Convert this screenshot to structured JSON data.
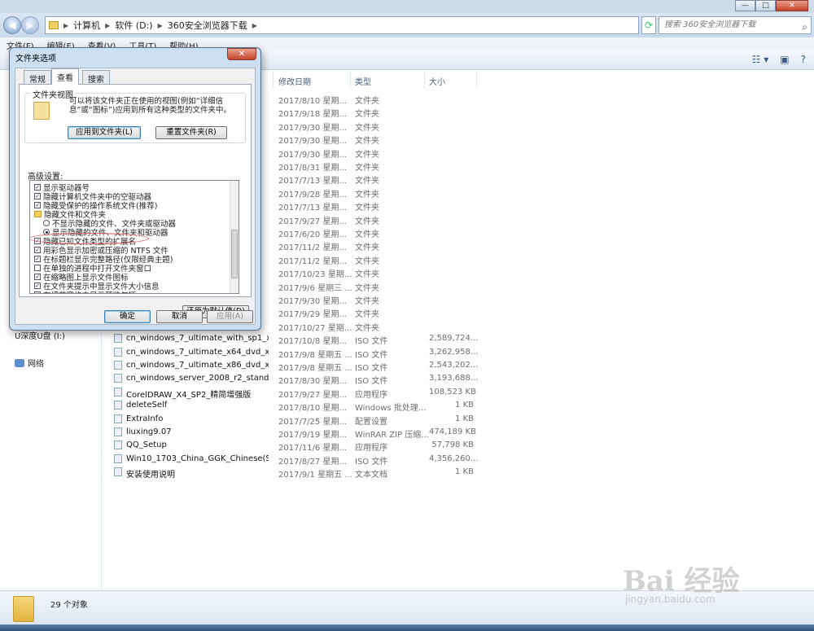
{
  "window": {
    "controls": {
      "minimize": "—",
      "maximize": "□",
      "close": "✕"
    }
  },
  "address": {
    "crumbs": [
      "计算机",
      "软件 (D:)",
      "360安全浏览器下载"
    ],
    "search_placeholder": "搜索 360安全浏览器下载"
  },
  "menu": [
    "文件(F)",
    "编辑(E)",
    "查看(V)",
    "工具(T)",
    "帮助(H)"
  ],
  "nav": [
    {
      "label": "U深度U盘 (I:)"
    },
    {
      "label": "网络"
    }
  ],
  "columns": {
    "date": "修改日期",
    "type": "类型",
    "size": "大小"
  },
  "files": [
    {
      "name": "",
      "date": "2017/8/10 星期...",
      "type": "文件夹",
      "size": ""
    },
    {
      "name": "",
      "date": "2017/9/18 星期...",
      "type": "文件夹",
      "size": ""
    },
    {
      "name": "",
      "date": "2017/9/30 星期...",
      "type": "文件夹",
      "size": ""
    },
    {
      "name": "",
      "date": "2017/9/30 星期...",
      "type": "文件夹",
      "size": ""
    },
    {
      "name": "",
      "date": "2017/9/30 星期...",
      "type": "文件夹",
      "size": ""
    },
    {
      "name": "",
      "date": "2017/8/31 星期...",
      "type": "文件夹",
      "size": ""
    },
    {
      "name": "",
      "date": "2017/7/13 星期...",
      "type": "文件夹",
      "size": ""
    },
    {
      "name": "",
      "date": "2017/9/28 星期...",
      "type": "文件夹",
      "size": ""
    },
    {
      "name": "",
      "date": "2017/7/13 星期...",
      "type": "文件夹",
      "size": ""
    },
    {
      "name": "",
      "date": "2017/9/27 星期...",
      "type": "文件夹",
      "size": ""
    },
    {
      "name": "",
      "date": "2017/6/20 星期...",
      "type": "文件夹",
      "size": ""
    },
    {
      "name": "",
      "date": "2017/11/2 星期...",
      "type": "文件夹",
      "size": ""
    },
    {
      "name": "",
      "date": "2017/11/2 星期...",
      "type": "文件夹",
      "size": ""
    },
    {
      "name": "",
      "date": "2017/10/23 星期...",
      "type": "文件夹",
      "size": ""
    },
    {
      "name": "",
      "date": "2017/9/6 星期三 ...",
      "type": "文件夹",
      "size": ""
    },
    {
      "name": "",
      "date": "2017/9/30 星期...",
      "type": "文件夹",
      "size": ""
    },
    {
      "name": "",
      "date": "2017/9/29 星期...",
      "type": "文件夹",
      "size": ""
    },
    {
      "name": "",
      "date": "2017/10/27 星期...",
      "type": "文件夹",
      "size": ""
    },
    {
      "name": "cn_windows_7_ultimate_with_sp1_x86_...",
      "date": "2017/10/8 星期...",
      "type": "ISO 文件",
      "size": "2,589,724..."
    },
    {
      "name": "cn_windows_7_ultimate_x64_dvd_x15-...",
      "date": "2017/9/8 星期五 ...",
      "type": "ISO 文件",
      "size": "3,262,958..."
    },
    {
      "name": "cn_windows_7_ultimate_x86_dvd_x15-...",
      "date": "2017/9/8 星期五 ...",
      "type": "ISO 文件",
      "size": "2,543,202..."
    },
    {
      "name": "cn_windows_server_2008_r2_standard...",
      "date": "2017/8/30 星期...",
      "type": "ISO 文件",
      "size": "3,193,688..."
    },
    {
      "name": "CorelDRAW_X4_SP2_精简增强版",
      "date": "2017/9/27 星期...",
      "type": "应用程序",
      "size": "108,523 KB"
    },
    {
      "name": "deleteSelf",
      "date": "2017/8/10 星期...",
      "type": "Windows 批处理...",
      "size": "1 KB"
    },
    {
      "name": "ExtraInfo",
      "date": "2017/7/25 星期...",
      "type": "配置设置",
      "size": "1 KB"
    },
    {
      "name": "liuxing9.07",
      "date": "2017/9/19 星期...",
      "type": "WinRAR ZIP 压缩...",
      "size": "474,189 KB"
    },
    {
      "name": "QQ_Setup",
      "date": "2017/11/6 星期...",
      "type": "应用程序",
      "size": "57,798 KB"
    },
    {
      "name": "Win10_1703_China_GGK_Chinese(Sim...",
      "date": "2017/8/27 星期...",
      "type": "ISO 文件",
      "size": "4,356,260..."
    },
    {
      "name": "安装使用说明",
      "date": "2017/9/1 星期五 ...",
      "type": "文本文档",
      "size": "1 KB"
    }
  ],
  "status": {
    "count": "29 个对象"
  },
  "dialog": {
    "title": "文件夹选项",
    "close": "✕",
    "tabs": [
      "常规",
      "查看",
      "搜索"
    ],
    "folder_views": {
      "legend": "文件夹视图",
      "description": "可以将该文件夹正在使用的视图(例如“详细信息”或“图标”)应用到所有这种类型的文件夹中。",
      "apply_btn": "应用到文件夹(L)",
      "reset_btn": "重置文件夹(R)"
    },
    "advanced_label": "高级设置:",
    "options": [
      {
        "kind": "checkbox",
        "checked": true,
        "label": "显示驱动器号"
      },
      {
        "kind": "checkbox",
        "checked": true,
        "label": "隐藏计算机文件夹中的空驱动器"
      },
      {
        "kind": "checkbox",
        "checked": true,
        "label": "隐藏受保护的操作系统文件(推荐)"
      },
      {
        "kind": "folder",
        "label": "隐藏文件和文件夹"
      },
      {
        "kind": "radio",
        "checked": false,
        "label": "不显示隐藏的文件、文件夹或驱动器",
        "indent": true
      },
      {
        "kind": "radio",
        "checked": true,
        "label": "显示隐藏的文件、文件夹和驱动器",
        "indent": true
      },
      {
        "kind": "checkbox",
        "checked": true,
        "label": "隐藏已知文件类型的扩展名"
      },
      {
        "kind": "checkbox",
        "checked": true,
        "label": "用彩色显示加密或压缩的 NTFS 文件"
      },
      {
        "kind": "checkbox",
        "checked": true,
        "label": "在标题栏显示完整路径(仅限经典主题)"
      },
      {
        "kind": "checkbox",
        "checked": false,
        "label": "在单独的进程中打开文件夹窗口"
      },
      {
        "kind": "checkbox",
        "checked": true,
        "label": "在缩略图上显示文件图标"
      },
      {
        "kind": "checkbox",
        "checked": true,
        "label": "在文件夹提示中显示文件大小信息"
      },
      {
        "kind": "checkbox",
        "checked": true,
        "label": "在细节窗格中显示预览句柄"
      }
    ],
    "restore_btn": "还原为默认值(D)",
    "ok": "确定",
    "cancel": "取消",
    "apply": "应用(A)"
  },
  "watermark": {
    "main": "Bai 经验",
    "sub": "jingyan.baidu.com"
  }
}
